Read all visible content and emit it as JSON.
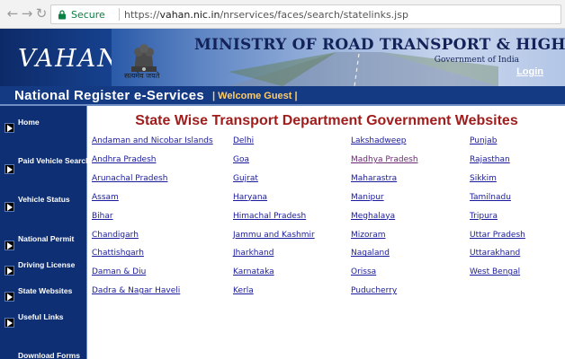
{
  "browser": {
    "secure_label": "Secure",
    "url_scheme": "https://",
    "url_host": "vahan.nic.in",
    "url_path": "/nrservices/faces/search/statelinks.jsp"
  },
  "header": {
    "logo_text": "VAHAN",
    "ministry_title": "MINISTRY  OF ROAD TRANSPORT & HIGHWAYS",
    "government_label": "Government of India",
    "login_label": "Login",
    "motto": "सत्यमेव जयते",
    "service_title": "National Register e-Services",
    "welcome_text": "| Welcome Guest |"
  },
  "sidebar": {
    "items": [
      {
        "label": "Home"
      },
      {
        "label": "Paid Vehicle Search"
      },
      {
        "label": "Vehicle Status"
      },
      {
        "label": "National Permit"
      },
      {
        "label": "Driving License"
      },
      {
        "label": "State Websites"
      },
      {
        "label": "Useful Links"
      },
      {
        "label": "Download Forms"
      }
    ]
  },
  "main": {
    "heading": "State Wise Transport Department Government Websites",
    "columns": [
      [
        "Andaman and Nicobar Islands",
        "Andhra Pradesh",
        "Arunachal Pradesh",
        "Assam",
        "Bihar",
        "Chandigarh",
        "Chattishgarh",
        "Daman & Diu",
        "Dadra & Nagar Haveli"
      ],
      [
        "Delhi",
        "Goa",
        "Gujrat",
        "Haryana",
        "Himachal Pradesh",
        "Jammu and Kashmir",
        "Jharkhand",
        "Karnataka",
        "Kerla"
      ],
      [
        "Lakshadweep",
        "Madhya Pradesh",
        "Maharastra",
        "Manipur",
        "Meghalaya",
        "Mizoram",
        "Nagaland",
        "Orissa",
        "Puducherry"
      ],
      [
        "Punjab",
        "Rajasthan",
        "Sikkim",
        "Tamilnadu",
        "Tripura",
        "Uttar Pradesh",
        "Uttarakhand",
        "West Bengal"
      ]
    ],
    "visited": [
      "Madhya Pradesh"
    ]
  },
  "colors": {
    "header_blue": "#16408c",
    "sidebar_blue": "#0e2f74",
    "heading_red": "#a01d1d",
    "link_blue": "#1a1a9c",
    "visited_purple": "#6b2a72",
    "secure_green": "#0b8043"
  },
  "icons": {
    "back": "arrow-left-icon",
    "forward": "arrow-right-icon",
    "reload": "reload-icon",
    "lock": "lock-icon",
    "emblem": "national-emblem-icon",
    "sidebar_bullet": "play-arrow-icon"
  }
}
